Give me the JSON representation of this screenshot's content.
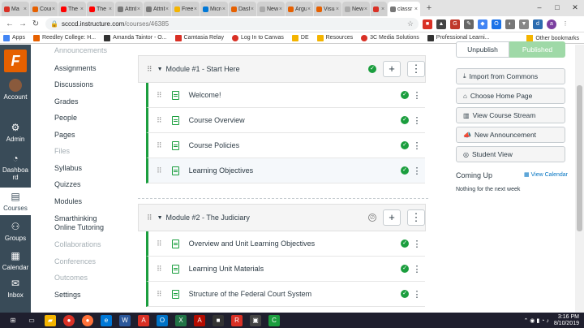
{
  "browser": {
    "tabs": [
      {
        "label": "Ma",
        "color": "#d93025",
        "active": false
      },
      {
        "label": "Course",
        "color": "#e66000",
        "active": false
      },
      {
        "label": "The ki",
        "color": "#ff0000",
        "active": false
      },
      {
        "label": "The ki",
        "color": "#ff0000",
        "active": false
      },
      {
        "label": "Attrib",
        "color": "#777777",
        "active": false
      },
      {
        "label": "Attrib",
        "color": "#777777",
        "active": false
      },
      {
        "label": "Free M",
        "color": "#f4b400",
        "active": false
      },
      {
        "label": "Micro",
        "color": "#0078d7",
        "active": false
      },
      {
        "label": "Dashb",
        "color": "#e66000",
        "active": false
      },
      {
        "label": "New tab",
        "color": "#aaaaaa",
        "active": false
      },
      {
        "label": "Argun",
        "color": "#e66000",
        "active": false
      },
      {
        "label": "Visual",
        "color": "#e66000",
        "active": false
      },
      {
        "label": "New Tab",
        "color": "#aaaaaa",
        "active": false
      },
      {
        "label": "",
        "color": "#d93025",
        "active": false
      },
      {
        "label": "classr",
        "color": "#777777",
        "active": true
      }
    ],
    "url_host": "scccd.instructure.com",
    "url_path": "/courses/46385",
    "bookmarks": [
      {
        "label": "Apps",
        "color": "#4285f4"
      },
      {
        "label": "Reedley College: H...",
        "color": "#e66000"
      },
      {
        "label": "Amanda Taintor - O...",
        "color": "#333333"
      },
      {
        "label": "Camtasia Relay",
        "color": "#d93025"
      },
      {
        "label": "Log In to Canvas",
        "color": "#d93025"
      },
      {
        "label": "DE",
        "color": "#f4b400"
      },
      {
        "label": "Resources",
        "color": "#f4b400"
      },
      {
        "label": "3C Media Solutions",
        "color": "#d93025"
      },
      {
        "label": "Professional Learni...",
        "color": "#333333"
      }
    ],
    "other_bookmarks": "Other bookmarks"
  },
  "global_nav": {
    "logo": "F",
    "items": [
      {
        "label": "Account",
        "icon": "account-icon"
      },
      {
        "label": "Admin",
        "icon": "admin-icon"
      },
      {
        "label": "Dashboard",
        "icon": "dashboard-icon"
      },
      {
        "label": "Courses",
        "icon": "courses-icon"
      },
      {
        "label": "Groups",
        "icon": "groups-icon"
      },
      {
        "label": "Calendar",
        "icon": "calendar-icon"
      },
      {
        "label": "Inbox",
        "icon": "inbox-icon"
      }
    ],
    "dashboard_label_line1": "Dashboa",
    "dashboard_label_line2": "rd"
  },
  "course_nav": [
    {
      "label": "Announcements",
      "dim": true
    },
    {
      "label": "Assignments",
      "dim": false
    },
    {
      "label": "Discussions",
      "dim": false
    },
    {
      "label": "Grades",
      "dim": false
    },
    {
      "label": "People",
      "dim": false
    },
    {
      "label": "Pages",
      "dim": false
    },
    {
      "label": "Files",
      "dim": true
    },
    {
      "label": "Syllabus",
      "dim": false
    },
    {
      "label": "Quizzes",
      "dim": false
    },
    {
      "label": "Modules",
      "dim": false
    },
    {
      "label": "Smarthinking",
      "dim": false
    },
    {
      "label": "Online Tutoring",
      "dim": false
    },
    {
      "label": "Collaborations",
      "dim": true
    },
    {
      "label": "Conferences",
      "dim": true
    },
    {
      "label": "Outcomes",
      "dim": true
    },
    {
      "label": "Settings",
      "dim": false
    }
  ],
  "modules": [
    {
      "title": "Module #1 - Start Here",
      "published": true,
      "items": [
        "Welcome!",
        "Course Overview",
        "Course Policies",
        "Learning Objectives"
      ]
    },
    {
      "title": "Module #2 - The Judiciary",
      "published": false,
      "items": [
        "Overview and Unit Learning Objectives",
        "Learning Unit Materials",
        "Structure of the Federal Court System"
      ]
    }
  ],
  "sidebar": {
    "unpublish": "Unpublish",
    "published": "Published",
    "buttons": [
      {
        "label": "Import from Commons",
        "icon": "import-icon"
      },
      {
        "label": "Choose Home Page",
        "icon": "home-icon"
      },
      {
        "label": "View Course Stream",
        "icon": "stream-icon"
      },
      {
        "label": "New Announcement",
        "icon": "announcement-icon"
      },
      {
        "label": "Student View",
        "icon": "student-view-icon"
      }
    ],
    "coming_up": "Coming Up",
    "view_calendar": "View Calendar",
    "nothing": "Nothing for the next week"
  },
  "taskbar": {
    "time": "3:16 PM",
    "date": "8/10/2019"
  }
}
